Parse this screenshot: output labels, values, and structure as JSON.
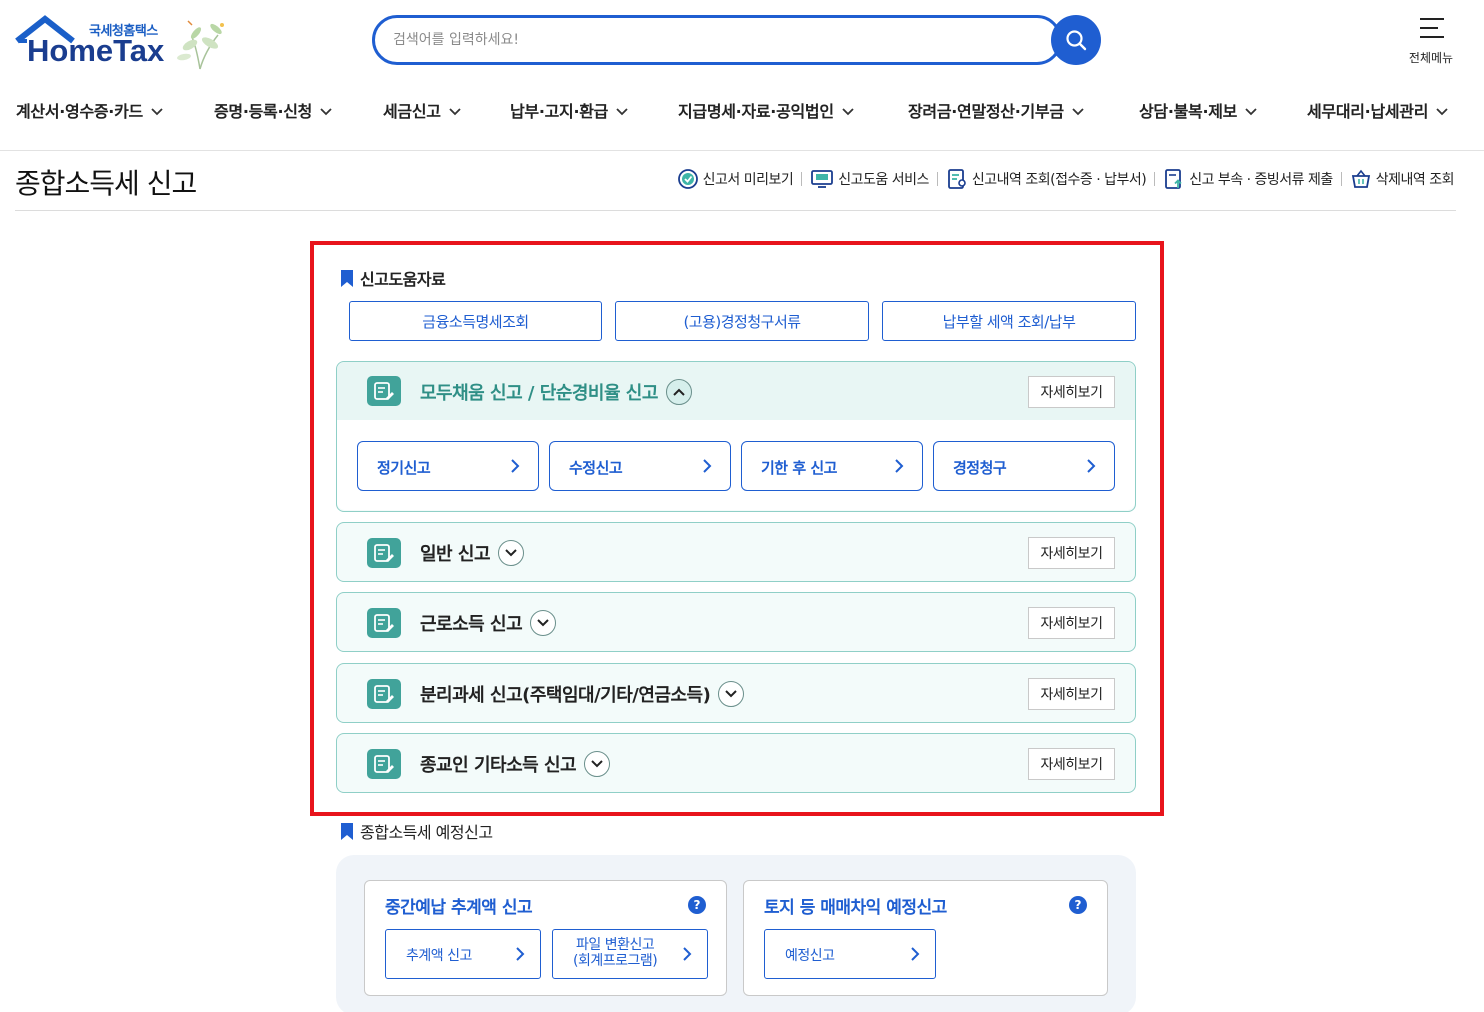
{
  "logo": {
    "sub": "국세청홈택스",
    "main": "HomeTax"
  },
  "search": {
    "placeholder": "검색어를 입력하세요!"
  },
  "all_menu": {
    "label": "전체메뉴"
  },
  "gnb": [
    "계산서·영수증·카드",
    "증명·등록·신청",
    "세금신고",
    "납부·고지·환급",
    "지급명세·자료·공익법인",
    "장려금·연말정산·기부금",
    "상담·불복·제보",
    "세무대리·납세관리"
  ],
  "page_title": "종합소득세 신고",
  "util_links": [
    {
      "label": "신고서 미리보기",
      "icon": "check-circle-icon"
    },
    {
      "label": "신고도움 서비스",
      "icon": "monitor-chat-icon"
    },
    {
      "label": "신고내역 조회(접수증 · 납부서)",
      "icon": "document-search-icon"
    },
    {
      "label": "신고 부속 · 증빙서류 제출",
      "icon": "document-upload-icon"
    },
    {
      "label": "삭제내역 조회",
      "icon": "trash-basket-icon"
    }
  ],
  "help_section": {
    "title": "신고도움자료",
    "buttons": [
      "금융소득명세조회",
      "(고용)경정청구서류",
      "납부할 세액 조회/납부"
    ]
  },
  "panels": [
    {
      "title": "모두채움 신고 / 단순경비율 신고",
      "detail": "자세히보기",
      "expanded": true,
      "sub_buttons": [
        "정기신고",
        "수정신고",
        "기한 후 신고",
        "경정청구"
      ]
    },
    {
      "title": "일반 신고",
      "detail": "자세히보기",
      "expanded": false
    },
    {
      "title": "근로소득 신고",
      "detail": "자세히보기",
      "expanded": false
    },
    {
      "title": "분리과세 신고(주택임대/기타/연금소득)",
      "detail": "자세히보기",
      "expanded": false
    },
    {
      "title": "종교인 기타소득 신고",
      "detail": "자세히보기",
      "expanded": false
    }
  ],
  "estimate_section": {
    "title": "종합소득세 예정신고",
    "cards": [
      {
        "title": "중간예납 추계액 신고",
        "help": "?",
        "buttons": [
          {
            "label": "추계액 신고"
          },
          {
            "line1": "파일 변환신고",
            "line2": "(회계프로그램)"
          }
        ]
      },
      {
        "title": "토지 등 매매차익 예정신고",
        "help": "?",
        "buttons": [
          {
            "label": "예정신고"
          }
        ]
      }
    ]
  },
  "colors": {
    "primary_blue": "#1f5ed1",
    "teal_icon": "#41a39a",
    "panel_border": "#8fcfc7",
    "highlight_red": "#e8141c"
  }
}
